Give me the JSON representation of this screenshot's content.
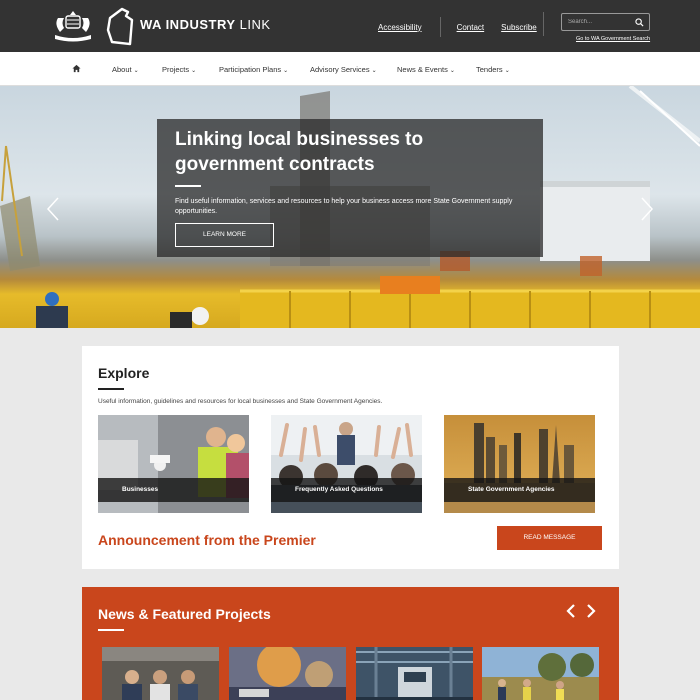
{
  "header": {
    "logo_text_bold": "WA INDUSTRY",
    "logo_text_light": "LINK",
    "links": {
      "accessibility": "Accessibility",
      "contact": "Contact",
      "subscribe": "Subscribe"
    },
    "search": {
      "placeholder": "Search...",
      "gov_search_link": "Go to WA Government Search"
    }
  },
  "nav": {
    "home_icon": "home-icon",
    "items": [
      {
        "label": "About"
      },
      {
        "label": "Projects"
      },
      {
        "label": "Participation Plans"
      },
      {
        "label": "Advisory Services"
      },
      {
        "label": "News & Events"
      },
      {
        "label": "Tenders"
      }
    ]
  },
  "hero": {
    "title": "Linking local businesses to government contracts",
    "description": "Find useful information, services and resources to help your business access more State Government supply opportunities.",
    "button_label": "LEARN MORE"
  },
  "explore": {
    "title": "Explore",
    "description": "Useful information, guidelines and resources for local businesses and State Government Agencies.",
    "cards": [
      {
        "label": "Businesses"
      },
      {
        "label": "Frequently Asked Questions"
      },
      {
        "label": "State Government Agencies"
      }
    ],
    "announcement": "Announcement from the Premier",
    "read_button": "READ MESSAGE"
  },
  "news": {
    "title": "News & Featured Projects"
  },
  "colors": {
    "header_bg": "#333333",
    "accent": "#c9461c",
    "panel_bg": "#ffffff",
    "page_bg": "#e9e9e9"
  }
}
